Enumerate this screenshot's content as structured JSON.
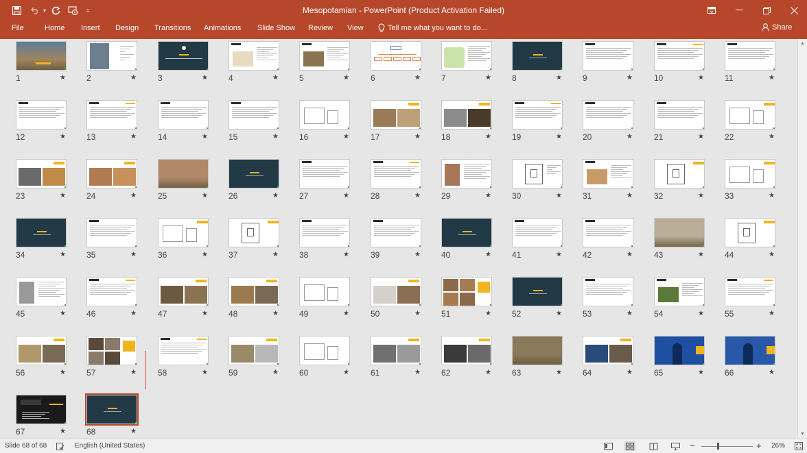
{
  "window": {
    "title": "Mesopotamian - PowerPoint (Product Activation Failed)",
    "accent": "#b7472a"
  },
  "quick_access": {
    "save_icon": "save-icon",
    "undo_icon": "undo-icon",
    "redo_icon": "redo-icon",
    "present_icon": "present-from-start-icon",
    "customize_icon": "customize-dropdown-icon"
  },
  "ribbon": {
    "tabs": [
      {
        "label": "File"
      },
      {
        "label": "Home"
      },
      {
        "label": "Insert"
      },
      {
        "label": "Design"
      },
      {
        "label": "Transitions"
      },
      {
        "label": "Animations"
      },
      {
        "label": "Slide Show"
      },
      {
        "label": "Review"
      },
      {
        "label": "View"
      }
    ],
    "tell_me": "Tell me what you want to do...",
    "share": "Share"
  },
  "slides": [
    {
      "n": "1",
      "star": "★",
      "kind": "photo",
      "c1": "#a0845c",
      "c2": "#5c7d9a"
    },
    {
      "n": "2",
      "star": "★",
      "kind": "gate"
    },
    {
      "n": "3",
      "star": "★",
      "kind": "dark-title"
    },
    {
      "n": "4",
      "star": "★",
      "kind": "text-map"
    },
    {
      "n": "5",
      "star": "★",
      "kind": "text-photo",
      "c1": "#8a7352"
    },
    {
      "n": "6",
      "star": "★",
      "kind": "diagram"
    },
    {
      "n": "7",
      "star": "★",
      "kind": "map"
    },
    {
      "n": "8",
      "star": "★",
      "kind": "dark"
    },
    {
      "n": "9",
      "star": "★",
      "kind": "text"
    },
    {
      "n": "10",
      "star": "★",
      "kind": "text"
    },
    {
      "n": "11",
      "star": "★",
      "kind": "text"
    },
    {
      "n": "12",
      "star": "★",
      "kind": "text"
    },
    {
      "n": "13",
      "star": "★",
      "kind": "text"
    },
    {
      "n": "14",
      "star": "★",
      "kind": "text"
    },
    {
      "n": "15",
      "star": "★",
      "kind": "text"
    },
    {
      "n": "16",
      "star": "★",
      "kind": "sketch"
    },
    {
      "n": "17",
      "star": "★",
      "kind": "two-photo",
      "c1": "#9a7b58",
      "c2": "#bda07a"
    },
    {
      "n": "18",
      "star": "★",
      "kind": "two-photo",
      "c1": "#8c8c8c",
      "c2": "#4a3a2a"
    },
    {
      "n": "19",
      "star": "★",
      "kind": "text"
    },
    {
      "n": "20",
      "star": "★",
      "kind": "text"
    },
    {
      "n": "21",
      "star": "★",
      "kind": "text"
    },
    {
      "n": "22",
      "star": "★",
      "kind": "sketch-accent"
    },
    {
      "n": "23",
      "star": "★",
      "kind": "two-photo",
      "c1": "#6a6a6a",
      "c2": "#c08a4a"
    },
    {
      "n": "24",
      "star": "★",
      "kind": "two-photo",
      "c1": "#b07a52",
      "c2": "#c8905a"
    },
    {
      "n": "25",
      "star": "★",
      "kind": "full-photo",
      "c1": "#b08868"
    },
    {
      "n": "26",
      "star": "★",
      "kind": "dark"
    },
    {
      "n": "27",
      "star": "★",
      "kind": "text"
    },
    {
      "n": "28",
      "star": "★",
      "kind": "text"
    },
    {
      "n": "29",
      "star": "★",
      "kind": "photo-text",
      "c1": "#a8775a"
    },
    {
      "n": "30",
      "star": "★",
      "kind": "plan"
    },
    {
      "n": "31",
      "star": "★",
      "kind": "text-photo",
      "c1": "#c89a6a"
    },
    {
      "n": "32",
      "star": "★",
      "kind": "plan-accent"
    },
    {
      "n": "33",
      "star": "★",
      "kind": "sketch-accent"
    },
    {
      "n": "34",
      "star": "★",
      "kind": "dark"
    },
    {
      "n": "35",
      "star": "★",
      "kind": "text"
    },
    {
      "n": "36",
      "star": "★",
      "kind": "sketch-accent"
    },
    {
      "n": "37",
      "star": "★",
      "kind": "plan-accent"
    },
    {
      "n": "38",
      "star": "★",
      "kind": "text"
    },
    {
      "n": "39",
      "star": "★",
      "kind": "text"
    },
    {
      "n": "40",
      "star": "★",
      "kind": "dark"
    },
    {
      "n": "41",
      "star": "★",
      "kind": "text"
    },
    {
      "n": "42",
      "star": "★",
      "kind": "text"
    },
    {
      "n": "43",
      "star": "★",
      "kind": "full-photo",
      "c1": "#b9ad97"
    },
    {
      "n": "44",
      "star": "★",
      "kind": "plan-accent"
    },
    {
      "n": "45",
      "star": "★",
      "kind": "photo-text",
      "c1": "#9a9a9a"
    },
    {
      "n": "46",
      "star": "★",
      "kind": "text"
    },
    {
      "n": "47",
      "star": "★",
      "kind": "two-photo",
      "c1": "#6b5a40",
      "c2": "#8a7350"
    },
    {
      "n": "48",
      "star": "★",
      "kind": "two-photo",
      "c1": "#9b7a4e",
      "c2": "#7a6a55"
    },
    {
      "n": "49",
      "star": "★",
      "kind": "sketch"
    },
    {
      "n": "50",
      "star": "★",
      "kind": "two-photo",
      "c1": "#d4d0cb",
      "c2": "#8a6f52"
    },
    {
      "n": "51",
      "star": "★",
      "kind": "grid-photo",
      "c1": "#8a6a4a",
      "c2": "#a77b50"
    },
    {
      "n": "52",
      "star": "★",
      "kind": "dark"
    },
    {
      "n": "53",
      "star": "★",
      "kind": "text"
    },
    {
      "n": "54",
      "star": "★",
      "kind": "text-photo",
      "c1": "#5a7a3a"
    },
    {
      "n": "55",
      "star": "★",
      "kind": "text"
    },
    {
      "n": "56",
      "star": "★",
      "kind": "two-photo",
      "c1": "#b0986a",
      "c2": "#7a6a55"
    },
    {
      "n": "57",
      "star": "★",
      "kind": "grid-photo",
      "c1": "#5a4a3a",
      "c2": "#8a7a6a"
    },
    {
      "n": "58",
      "star": "★",
      "kind": "text"
    },
    {
      "n": "59",
      "star": "★",
      "kind": "two-photo",
      "c1": "#9a8a6a",
      "c2": "#b8b8b8"
    },
    {
      "n": "60",
      "star": "★",
      "kind": "sketch"
    },
    {
      "n": "61",
      "star": "★",
      "kind": "two-photo",
      "c1": "#707070",
      "c2": "#9a9a9a"
    },
    {
      "n": "62",
      "star": "★",
      "kind": "two-photo",
      "c1": "#3a3a3a",
      "c2": "#6a6a6a"
    },
    {
      "n": "63",
      "star": "★",
      "kind": "full-photo",
      "c1": "#8a7a5a"
    },
    {
      "n": "64",
      "star": "★",
      "kind": "two-photo",
      "c1": "#2a4a7a",
      "c2": "#6a5a4a"
    },
    {
      "n": "65",
      "star": "★",
      "kind": "blue-gate",
      "c1": "#1f4fa0"
    },
    {
      "n": "66",
      "star": "★",
      "kind": "blue-gate",
      "c1": "#2a58a8"
    },
    {
      "n": "67",
      "star": "★",
      "kind": "dark-photo"
    },
    {
      "n": "68",
      "star": "★",
      "kind": "dark",
      "selected": true
    }
  ],
  "statusbar": {
    "slide_info": "Slide 68 of 68",
    "language": "English (United States)",
    "zoom": "26%",
    "zoom_out": "−",
    "zoom_in": "+"
  },
  "colors": {
    "dark_slide": "#223a45",
    "accent_yellow": "#f2b41c"
  }
}
